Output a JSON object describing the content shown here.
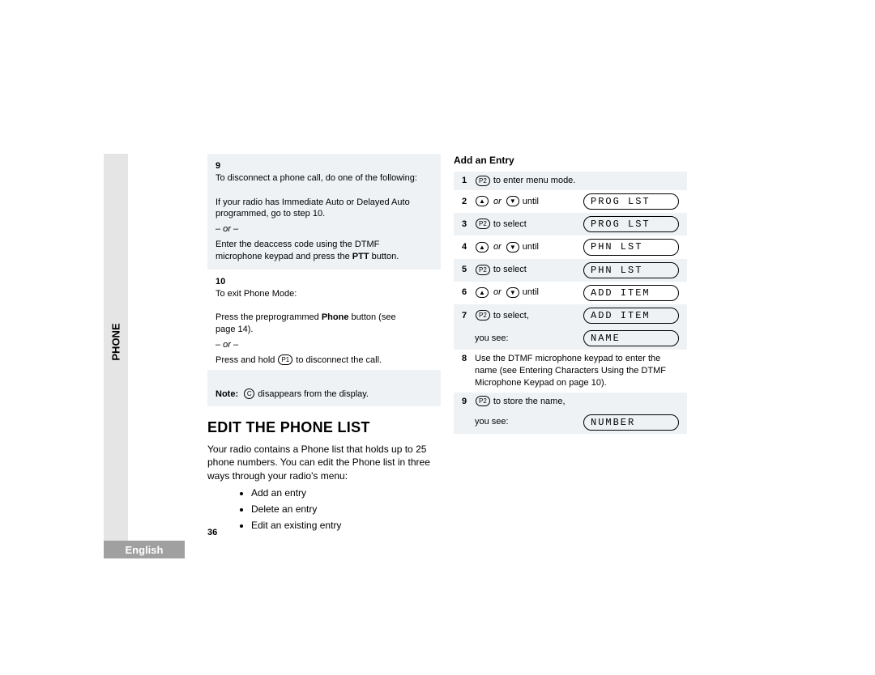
{
  "sidebar": {
    "tab": "PHONE",
    "language": "English"
  },
  "page_number": "36",
  "left": {
    "step9_num": "9",
    "step9_line1": "To disconnect a phone call, do one of the following:",
    "step9_line2": "If your radio has Immediate Auto or Delayed Auto programmed, go to step 10.",
    "step9_or": "– or –",
    "step9_line3a": "Enter the deaccess code using the DTMF microphone keypad and press the ",
    "step9_line3b": "PTT",
    "step9_line3c": " button.",
    "step10_num": "10",
    "step10_line1": "To exit Phone Mode:",
    "step10_line2a": "Press the preprogrammed ",
    "step10_line2b": "Phone",
    "step10_line2c": " button (see page 14).",
    "step10_or": "– or –",
    "step10_line3a": "Press and hold ",
    "step10_key": "P1",
    "step10_line3b": " to disconnect the call.",
    "note_label": "Note:",
    "note_icon": "C",
    "note_text": " disappears from the display.",
    "heading": "EDIT THE PHONE LIST",
    "intro": "Your radio contains a Phone list that holds up to 25 phone numbers. You can edit the Phone list in three ways through your radio's menu:",
    "bullets": [
      "Add an entry",
      "Delete an entry",
      "Edit an existing entry"
    ]
  },
  "right": {
    "heading": "Add an Entry",
    "r1": {
      "n": "1",
      "key": "P2",
      "txt": " to enter menu mode."
    },
    "r2": {
      "n": "2",
      "up": "▲",
      "dn": "▼",
      "or": "or",
      "txt": " until",
      "lcd": "PROG  LST"
    },
    "r3": {
      "n": "3",
      "key": "P2",
      "txt": " to select",
      "lcd": "PROG  LST"
    },
    "r4": {
      "n": "4",
      "up": "▲",
      "dn": "▼",
      "or": "or",
      "txt": " until",
      "lcd": "PHN  LST"
    },
    "r5": {
      "n": "5",
      "key": "P2",
      "txt": " to select",
      "lcd": "PHN  LST"
    },
    "r6": {
      "n": "6",
      "up": "▲",
      "dn": "▼",
      "or": "or",
      "txt": " until",
      "lcd": "ADD  ITEM"
    },
    "r7": {
      "n": "7",
      "key": "P2",
      "txt": " to select,",
      "lcd": "ADD  ITEM"
    },
    "r7b": {
      "txt": "you see:",
      "lcd": "NAME"
    },
    "r8": {
      "n": "8",
      "txt": "Use the DTMF microphone keypad to enter the name (see Entering Characters Using the DTMF Microphone Keypad on page 10)."
    },
    "r9": {
      "n": "9",
      "key": "P2",
      "txt": " to store the name,"
    },
    "r9b": {
      "txt": "you see:",
      "lcd": "NUMBER"
    }
  }
}
